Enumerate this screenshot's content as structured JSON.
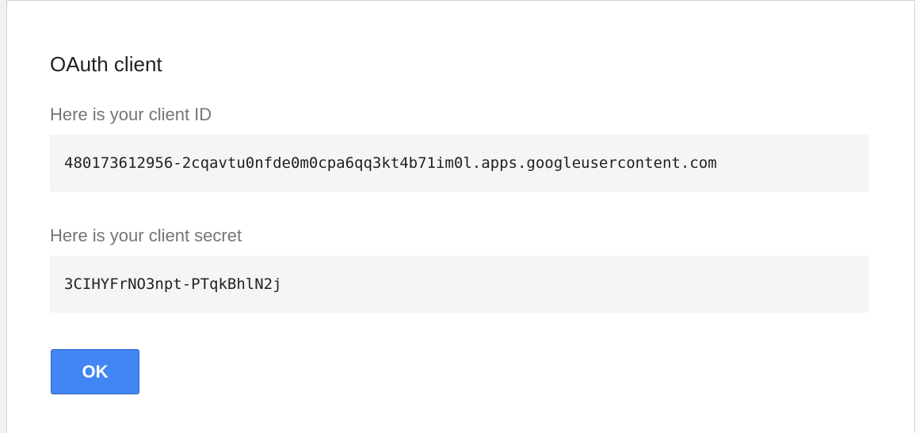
{
  "dialog": {
    "title": "OAuth client",
    "client_id_label": "Here is your client ID",
    "client_id_value": "480173612956-2cqavtu0nfde0m0cpa6qq3kt4b71im0l.apps.googleusercontent.com",
    "client_secret_label": "Here is your client secret",
    "client_secret_value": "3CIHYFrNO3npt-PTqkBhlN2j",
    "ok_label": "OK"
  },
  "colors": {
    "primary_button": "#4285f4",
    "code_background": "#f5f5f5",
    "label_text": "#757575"
  }
}
